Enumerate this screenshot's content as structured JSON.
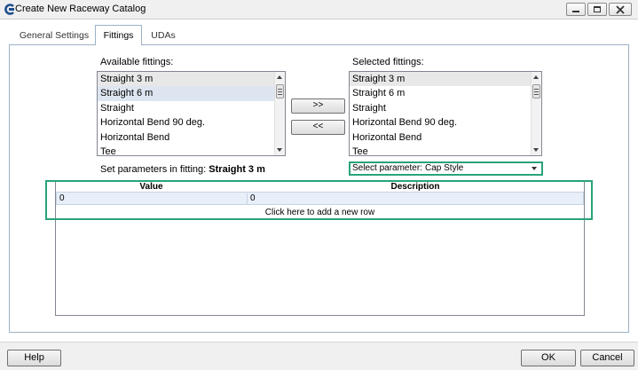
{
  "window": {
    "title": "Create New Raceway Catalog",
    "icon": "app-c-icon",
    "controls": [
      "minimize-icon",
      "maximize-icon",
      "close-icon"
    ]
  },
  "tabs": [
    {
      "label": "General Settings",
      "active": false
    },
    {
      "label": "Fittings",
      "active": true
    },
    {
      "label": "UDAs",
      "active": false
    }
  ],
  "available": {
    "label": "Available fittings:",
    "items": [
      "Straight 3 m",
      "Straight 6 m",
      "Straight",
      "Horizontal Bend 90 deg.",
      "Horizontal Bend",
      "Tee"
    ]
  },
  "selected": {
    "label": "Selected fittings:",
    "items": [
      "Straight 3 m",
      "Straight 6 m",
      "Straight",
      "Horizontal Bend 90 deg.",
      "Horizontal Bend",
      "Tee"
    ]
  },
  "move": {
    "add_label": ">>",
    "remove_label": "<<"
  },
  "parameters": {
    "fitting_label": "Set parameters in fitting:",
    "fitting_name": "Straight 3 m",
    "select_label": "Select parameter:",
    "select_value": "Cap Style"
  },
  "grid": {
    "columns": [
      "Value",
      "Description"
    ],
    "rows": [
      {
        "value": "0",
        "description": "0"
      }
    ],
    "add_row_text": "Click here to add a new row"
  },
  "footer": {
    "help_label": "Help",
    "ok_label": "OK",
    "cancel_label": "Cancel"
  },
  "colors": {
    "highlight_border": "#2aa37a",
    "selected_row": "#e8eff8",
    "panel_border": "#9cb2c6"
  }
}
